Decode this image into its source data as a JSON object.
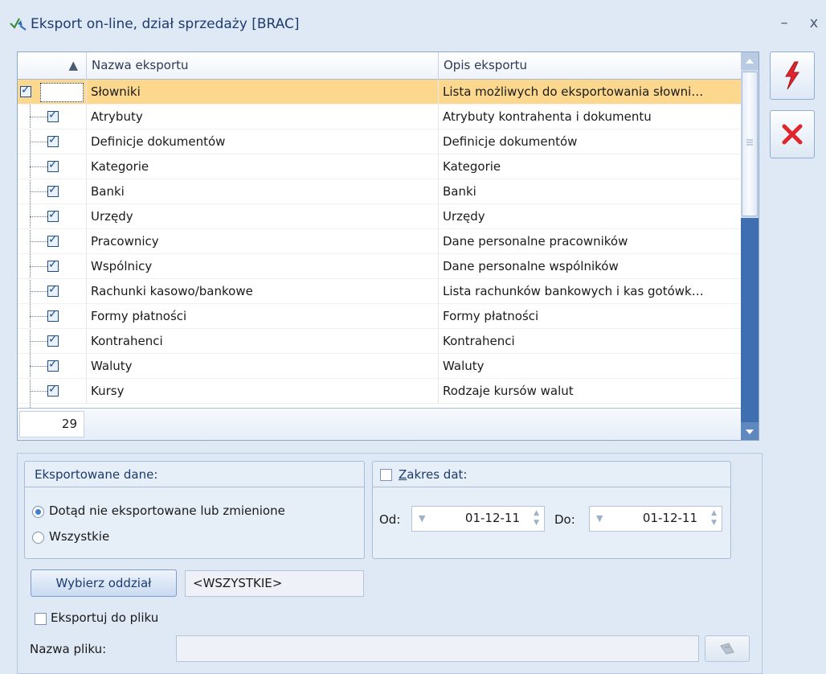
{
  "window": {
    "title": "Eksport on-line, dział sprzedaży [BRAC]",
    "minimize": "–",
    "close": "x"
  },
  "grid": {
    "columns": {
      "name": "Nazwa eksportu",
      "description": "Opis eksportu"
    },
    "sort_indicator": "▲",
    "rows": [
      {
        "name": "Słowniki",
        "description": "Lista możliwych do eksportowania słowni…",
        "checked": true,
        "selected": true
      },
      {
        "name": "Atrybuty",
        "description": "Atrybuty kontrahenta i dokumentu",
        "checked": true
      },
      {
        "name": "Definicje dokumentów",
        "description": "Definicje dokumentów",
        "checked": true
      },
      {
        "name": "Kategorie",
        "description": "Kategorie",
        "checked": true
      },
      {
        "name": "Banki",
        "description": "Banki",
        "checked": true
      },
      {
        "name": "Urzędy",
        "description": "Urzędy",
        "checked": true
      },
      {
        "name": "Pracownicy",
        "description": "Dane personalne pracowników",
        "checked": true
      },
      {
        "name": "Wspólnicy",
        "description": "Dane personalne wspólników",
        "checked": true
      },
      {
        "name": "Rachunki kasowo/bankowe",
        "description": "Lista rachunków bankowych i kas gotówk…",
        "checked": true
      },
      {
        "name": "Formy płatności",
        "description": "Formy płatności",
        "checked": true
      },
      {
        "name": "Kontrahenci",
        "description": "Kontrahenci",
        "checked": true
      },
      {
        "name": "Waluty",
        "description": "Waluty",
        "checked": true
      },
      {
        "name": "Kursy",
        "description": "Rodzaje kursów walut",
        "checked": true
      }
    ],
    "count": "29"
  },
  "side_buttons": {
    "export": "lightning-icon",
    "cancel": "close-icon"
  },
  "colors": {
    "selected_row": "#fbd88e",
    "export_icon": "#e0262a",
    "cancel_icon": "#e0262a"
  },
  "exported_data": {
    "title": "Eksportowane dane:",
    "options": [
      {
        "label": "Dotąd nie eksportowane lub zmienione",
        "selected": true
      },
      {
        "label": "Wszystkie",
        "selected": false
      }
    ]
  },
  "date_range": {
    "label": "Zakres dat:",
    "checked": false,
    "from_label": "Od:",
    "from_value": "01-12-11",
    "to_label": "Do:",
    "to_value": "01-12-11"
  },
  "branch": {
    "button": "Wybierz oddział",
    "value": "<WSZYSTKIE>"
  },
  "export_file": {
    "label": "Eksportuj do pliku",
    "checked": false
  },
  "filename": {
    "label": "Nazwa pliku:",
    "value": ""
  }
}
